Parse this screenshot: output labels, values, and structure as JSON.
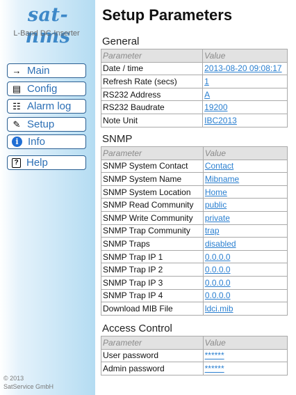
{
  "sidebar": {
    "logo": "sat-nms",
    "subtitle": "L-Band DC-Inserter",
    "nav": [
      {
        "label": "Main",
        "icon": "arrow-right-icon",
        "glyph": "→"
      },
      {
        "label": "Config",
        "icon": "config-device-icon",
        "glyph": "▤"
      },
      {
        "label": "Alarm log",
        "icon": "alarm-log-icon",
        "glyph": "☷"
      },
      {
        "label": "Setup",
        "icon": "wrench-icon",
        "glyph": "✎"
      },
      {
        "label": "Info",
        "icon": "info-icon",
        "glyph": "i"
      },
      {
        "label": "Help",
        "icon": "help-icon",
        "glyph": "?"
      }
    ],
    "footer_line1": "© 2013",
    "footer_line2": "SatService GmbH"
  },
  "page": {
    "title": "Setup Parameters",
    "col_param": "Parameter",
    "col_value": "Value"
  },
  "sections": {
    "general": {
      "title": "General",
      "rows": [
        {
          "param": "Date / time",
          "value": "2013-08-20 09:08:17"
        },
        {
          "param": "Refresh Rate (secs)",
          "value": "1"
        },
        {
          "param": "RS232 Address",
          "value": "A"
        },
        {
          "param": "RS232 Baudrate",
          "value": "19200"
        },
        {
          "param": "Note Unit",
          "value": "IBC2013"
        }
      ]
    },
    "snmp": {
      "title": "SNMP",
      "rows": [
        {
          "param": "SNMP System Contact",
          "value": "Contact"
        },
        {
          "param": "SNMP System Name",
          "value": "Mibname"
        },
        {
          "param": "SNMP System Location",
          "value": "Home"
        },
        {
          "param": "SNMP Read Community",
          "value": "public"
        },
        {
          "param": "SNMP Write Community",
          "value": "private"
        },
        {
          "param": "SNMP Trap Community",
          "value": "trap"
        },
        {
          "param": "SNMP Traps",
          "value": "disabled"
        },
        {
          "param": "SNMP Trap IP 1",
          "value": "0.0.0.0"
        },
        {
          "param": "SNMP Trap IP 2",
          "value": "0.0.0.0"
        },
        {
          "param": "SNMP Trap IP 3",
          "value": "0.0.0.0"
        },
        {
          "param": "SNMP Trap IP 4",
          "value": "0.0.0.0"
        },
        {
          "param": "Download MIB File",
          "value": "ldci.mib"
        }
      ]
    },
    "access": {
      "title": "Access Control",
      "rows": [
        {
          "param": "User password",
          "value": "******"
        },
        {
          "param": "Admin password",
          "value": "******"
        }
      ]
    }
  },
  "colors": {
    "link": "#2a7fd0",
    "logo": "#3d88c8",
    "header_bg": "#e2e2e2"
  }
}
